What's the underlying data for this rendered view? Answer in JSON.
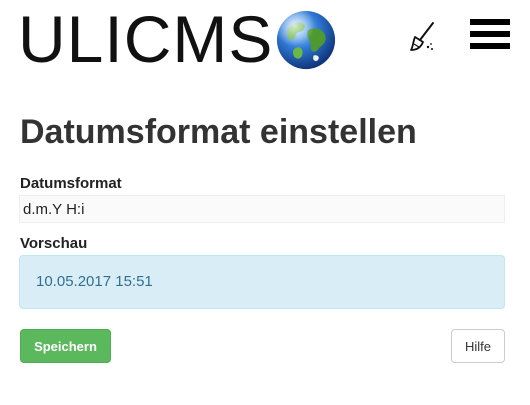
{
  "header": {
    "logo_text": "ULICMS",
    "clean_icon": "broom-icon",
    "menu_icon": "hamburger-menu-icon"
  },
  "main": {
    "title": "Datumsformat einstellen",
    "format_label": "Datumsformat",
    "format_value": "d.m.Y H:i",
    "preview_label": "Vorschau",
    "preview_value": "10.05.2017 15:51",
    "save_label": "Speichern",
    "help_label": "Hilfe"
  },
  "colors": {
    "save_button": "#5cb85c",
    "preview_background": "#d9edf7",
    "preview_text": "#31708f"
  }
}
